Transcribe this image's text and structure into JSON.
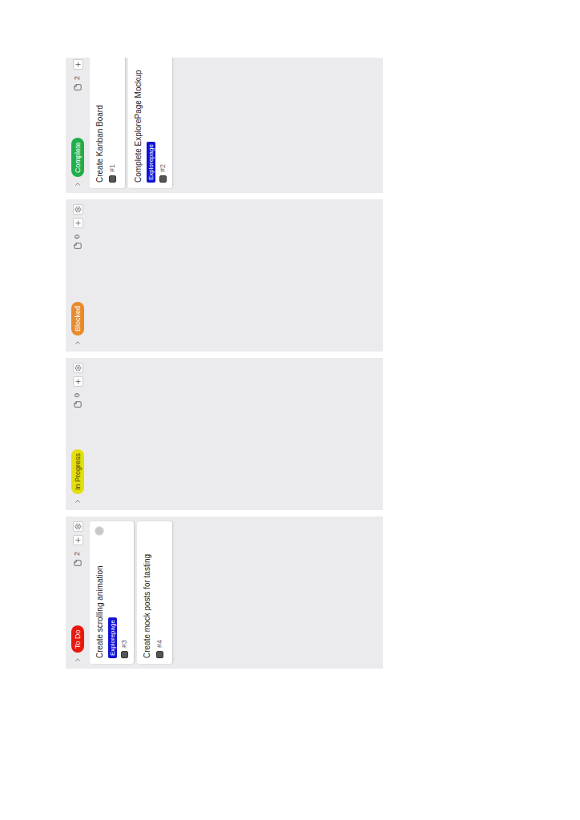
{
  "board": {
    "columns": [
      {
        "title": "To Do",
        "color": "#e8180c",
        "count": "2",
        "cards": [
          {
            "title": "Create scrolling animation",
            "tags": [
              {
                "label": "Explorepage",
                "color": "#1212d6"
              }
            ],
            "number": "#3",
            "assigned": true
          },
          {
            "title": "Create mock posts for tasting",
            "tags": [],
            "number": "#4",
            "assigned": false
          }
        ]
      },
      {
        "title": "In Progress",
        "color": "#e4de0a",
        "count": "0",
        "cards": []
      },
      {
        "title": "Blocked",
        "color": "#e8892a",
        "count": "0",
        "cards": []
      },
      {
        "title": "Complete",
        "color": "#1fae4b",
        "count": "2",
        "cards": [
          {
            "title": "Create Kanban Board",
            "tags": [],
            "number": "#1",
            "assigned": false
          },
          {
            "title": "Complete ExplorePage Mockup",
            "tags": [
              {
                "label": "Explorepage",
                "color": "#1212d6"
              }
            ],
            "number": "#2",
            "assigned": false
          }
        ]
      }
    ]
  }
}
